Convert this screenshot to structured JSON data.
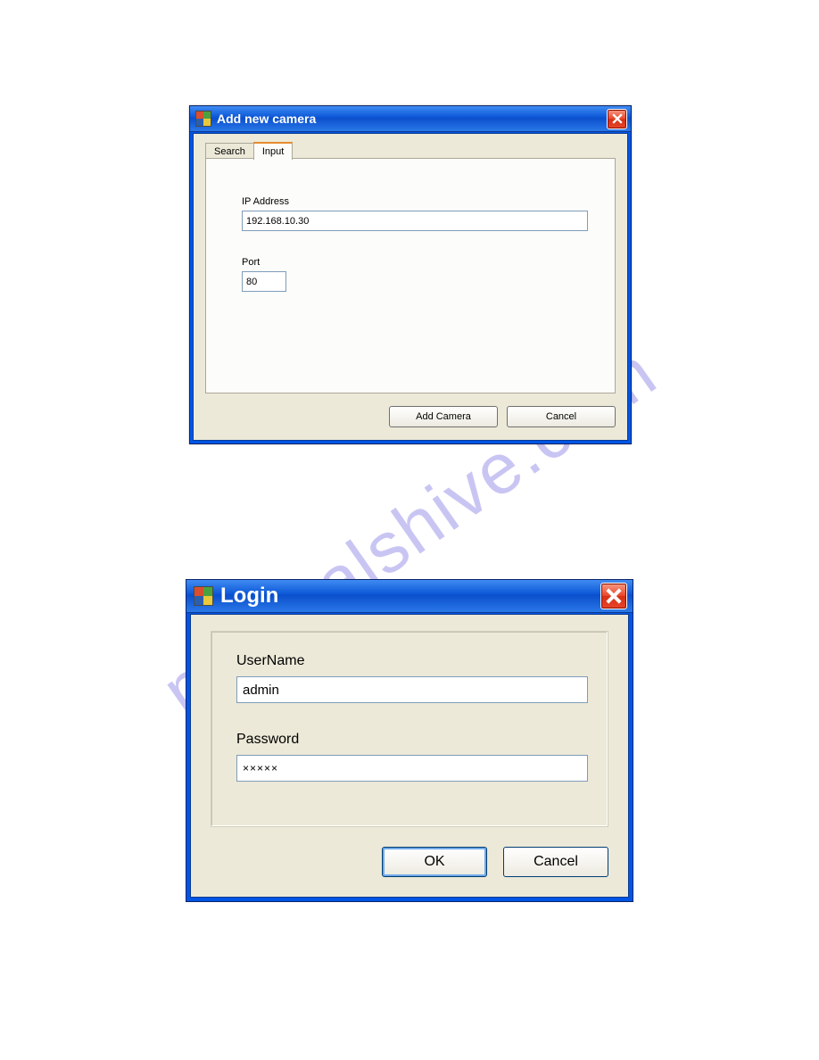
{
  "watermark": "manualshive.com",
  "add_camera": {
    "title": "Add new camera",
    "tabs": {
      "search": "Search",
      "input": "Input"
    },
    "ip_label": "IP Address",
    "ip_value": "192.168.10.30",
    "port_label": "Port",
    "port_value": "80",
    "btn_add": "Add Camera",
    "btn_cancel": "Cancel"
  },
  "login": {
    "title": "Login",
    "user_label": "UserName",
    "user_value": "admin",
    "pass_label": "Password",
    "pass_value": "×××××",
    "btn_ok": "OK",
    "btn_cancel": "Cancel"
  }
}
